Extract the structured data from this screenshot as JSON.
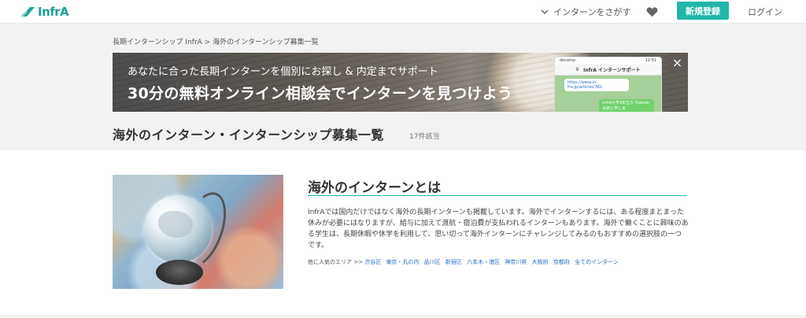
{
  "header": {
    "logo_text": "InfrA",
    "nav_search_label": "インターンをさがす",
    "signup_label": "新規登録",
    "login_label": "ログイン",
    "accent_color": "#21b6a8"
  },
  "breadcrumb": {
    "items": [
      "長期インターンシップ InfrA",
      "海外のインターンシップ募集一覧"
    ],
    "separator": ">"
  },
  "banner": {
    "subtitle": "あなたに合った長期インターンを個別にお探し & 内定までサポート",
    "headline": "30分の無料オンライン相談会でインターンを見つけよう",
    "close_icon": "×",
    "phone": {
      "carrier": "docomo",
      "time": "12:51",
      "chat_title": "InfrA インターンサポート",
      "back_count": "9",
      "link_text": "https://www.in-fra.jp/articles/362",
      "reply_text": "InfrA大学3年生の Trainee太郎と申しま"
    }
  },
  "page": {
    "title": "海外のインターン・インターンシップ募集一覧",
    "count": "17件該当"
  },
  "section": {
    "title": "海外のインターンとは",
    "description": "InfrAでは国内だけではなく海外の長期インターンも掲載しています。海外でインターンするには、ある程度まとまった休みが必要にはなりますが、給与に加えて渡航・宿泊費が支払われるインターンもあります。海外で働くことに興味のある学生は、長期休暇や休学を利用して、思い切って海外インターンにチャレンジしてみるのもおすすめの選択肢の一つです。",
    "areas_label": "他に人気のエリア >>",
    "areas": [
      "渋谷区",
      "東京・丸の内",
      "品川区",
      "新宿区",
      "六本木・港区",
      "神奈川県",
      "大阪府",
      "京都府",
      "全てのインターン"
    ]
  }
}
